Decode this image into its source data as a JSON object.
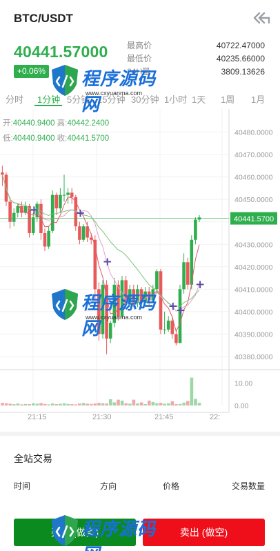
{
  "header": {
    "pair": "BTC/USDT",
    "back_icon": "back-arrow-icon"
  },
  "ticker": {
    "price": "40441.57000",
    "change": "+0.06%",
    "stats": [
      {
        "label": "最高价",
        "value": "40722.47000"
      },
      {
        "label": "最低价",
        "value": "40235.66000"
      },
      {
        "label": "24H量",
        "value": "3809.13626"
      }
    ]
  },
  "tabs": [
    "分时",
    "1分钟",
    "5分钟",
    "15分钟",
    "30分钟",
    "1小时",
    "1天",
    "1周",
    "1月"
  ],
  "active_tab": "1分钟",
  "ohlc": {
    "open_label": "开:",
    "open": "40440.9400",
    "high_label": "高:",
    "high": "40442.2400",
    "low_label": "低:",
    "low": "40440.9400",
    "close_label": "收:",
    "close": "40441.5700"
  },
  "chart_data": {
    "type": "candlestick",
    "y_ticks": [
      "40480.0000",
      "40470.0000",
      "40460.0000",
      "40450.0000",
      "40440.0000",
      "40430.0000",
      "40420.0000",
      "40410.0000",
      "40400.0000",
      "40390.0000",
      "40380.0000"
    ],
    "ylim": [
      40376,
      40486
    ],
    "last_price_label": "40441.5700",
    "x_ticks": [
      "21:15",
      "21:30",
      "21:45",
      "22:"
    ],
    "volume_ticks": [
      "10.00",
      "0.00"
    ],
    "candles": [
      [
        40462,
        40461,
        40465,
        40456
      ],
      [
        40461,
        40449,
        40462,
        40447
      ],
      [
        40449,
        40440,
        40451,
        40437
      ],
      [
        40440,
        40444,
        40446,
        40438
      ],
      [
        40444,
        40447,
        40448,
        40442
      ],
      [
        40447,
        40444,
        40449,
        40442
      ],
      [
        40444,
        40447,
        40449,
        40443
      ],
      [
        40447,
        40435,
        40448,
        40433
      ],
      [
        40435,
        40442,
        40444,
        40434
      ],
      [
        40442,
        40448,
        40449,
        40440
      ],
      [
        40448,
        40435,
        40450,
        40432
      ],
      [
        40435,
        40429,
        40437,
        40427
      ],
      [
        40429,
        40436,
        40438,
        40428
      ],
      [
        40436,
        40452,
        40454,
        40435
      ],
      [
        40452,
        40446,
        40453,
        40443
      ],
      [
        40446,
        40452,
        40455,
        40444
      ],
      [
        40452,
        40452,
        40461,
        40449
      ],
      [
        40452,
        40453,
        40455,
        40448
      ],
      [
        40453,
        40451,
        40455,
        40448
      ],
      [
        40451,
        40438,
        40452,
        40436
      ],
      [
        40438,
        40432,
        40440,
        40430
      ],
      [
        40432,
        40438,
        40439,
        40431
      ],
      [
        40438,
        40433,
        40440,
        40431
      ],
      [
        40433,
        40432,
        40435,
        40430
      ],
      [
        40432,
        40410,
        40434,
        40405
      ],
      [
        40410,
        40390,
        40413,
        40387
      ],
      [
        40390,
        40412,
        40414,
        40388
      ],
      [
        40412,
        40388,
        40414,
        40381
      ],
      [
        40388,
        40395,
        40396,
        40386
      ],
      [
        40395,
        40412,
        40415,
        40393
      ],
      [
        40412,
        40398,
        40414,
        40396
      ],
      [
        40398,
        40414,
        40416,
        40397
      ],
      [
        40414,
        40404,
        40416,
        40402
      ],
      [
        40404,
        40410,
        40412,
        40402
      ],
      [
        40410,
        40404,
        40412,
        40402
      ],
      [
        40404,
        40410,
        40412,
        40402
      ],
      [
        40410,
        40404,
        40411,
        40402
      ],
      [
        40404,
        40409,
        40411,
        40403
      ],
      [
        40409,
        40405,
        40411,
        40403
      ],
      [
        40405,
        40410,
        40412,
        40404
      ],
      [
        40410,
        40418,
        40419,
        40408
      ],
      [
        40418,
        40392,
        40419,
        40390
      ],
      [
        40392,
        40392,
        40400,
        40390
      ],
      [
        40392,
        40396,
        40398,
        40391
      ],
      [
        40396,
        40390,
        40398,
        40388
      ],
      [
        40390,
        40386,
        40392,
        40385
      ],
      [
        40386,
        40410,
        40412,
        40386
      ],
      [
        40410,
        40422,
        40426,
        40408
      ],
      [
        40422,
        40412,
        40424,
        40410
      ],
      [
        40412,
        40432,
        40434,
        40410
      ],
      [
        40432,
        40441,
        40442,
        40430
      ],
      [
        40441,
        40442,
        40443,
        40440
      ]
    ],
    "volumes": [
      1.2,
      1.0,
      0.8,
      0.6,
      0.9,
      0.5,
      0.7,
      0.6,
      1.0,
      0.8,
      1.1,
      0.7,
      0.5,
      0.9,
      0.6,
      0.8,
      1.0,
      0.7,
      0.6,
      0.5,
      0.9,
      1.1,
      0.8,
      0.7,
      0.9,
      1.2,
      1.0,
      0.9,
      2.8,
      1.4,
      2.6,
      2.2,
      1.0,
      0.8,
      2.6,
      0.9,
      1.4,
      0.6,
      2.2,
      1.6,
      1.0,
      1.2,
      0.8,
      1.0,
      1.9,
      0.6,
      0.7,
      1.3,
      2.0,
      12.5,
      3.0,
      1.2,
      0.8
    ],
    "markers": [
      "+",
      "+",
      "+",
      "+",
      "+",
      "+"
    ]
  },
  "watermark": {
    "text": "程序源码网",
    "url": "www.cxyuanma.com"
  },
  "trades": {
    "title": "全站交易",
    "headers": [
      "时间",
      "方向",
      "价格",
      "交易数量"
    ]
  },
  "actions": {
    "buy": "买入 (做多)",
    "sell": "卖出 (做空)"
  },
  "colors": {
    "up": "#2fae4e",
    "down": "#e85a5a",
    "buy_button": "#0b8a1f",
    "sell_button": "#ee0f1b",
    "ma_red": "#e05a67",
    "ma_pink": "#e6a0c8",
    "ma_green": "#7ac47a",
    "marker": "#5a4aa8"
  }
}
